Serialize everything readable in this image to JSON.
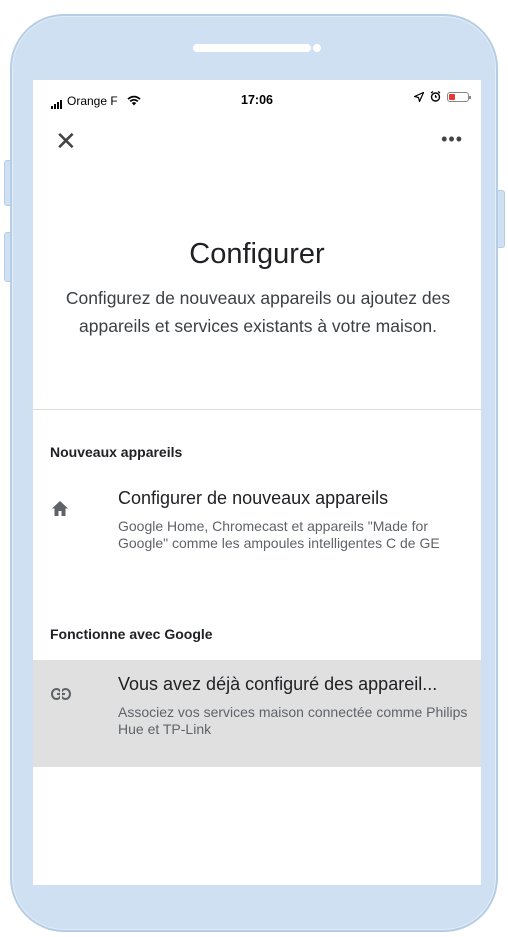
{
  "status_bar": {
    "carrier": "Orange F",
    "time": "17:06",
    "battery_color": "#e53935"
  },
  "toolbar": {
    "close_icon": "close-icon",
    "more_icon": "more-options-icon"
  },
  "header": {
    "title": "Configurer",
    "subtitle": "Configurez de nouveaux appareils ou ajoutez des appareils et services existants à votre maison."
  },
  "sections": [
    {
      "title": "Nouveaux appareils",
      "item": {
        "icon": "home-icon",
        "title": "Configurer de nouveaux appareils",
        "description": "Google Home, Chromecast et appareils \"Made for Google\" comme les ampoules intelligentes C de GE"
      }
    },
    {
      "title": "Fonctionne avec Google",
      "item": {
        "icon": "link-icon",
        "title": "Vous avez déjà configuré des appareil...",
        "description": "Associez vos services maison connectée comme Philips Hue et TP-Link"
      }
    }
  ],
  "colors": {
    "frame": "#cfe0f2",
    "highlight_row": "#e0e0e0"
  }
}
